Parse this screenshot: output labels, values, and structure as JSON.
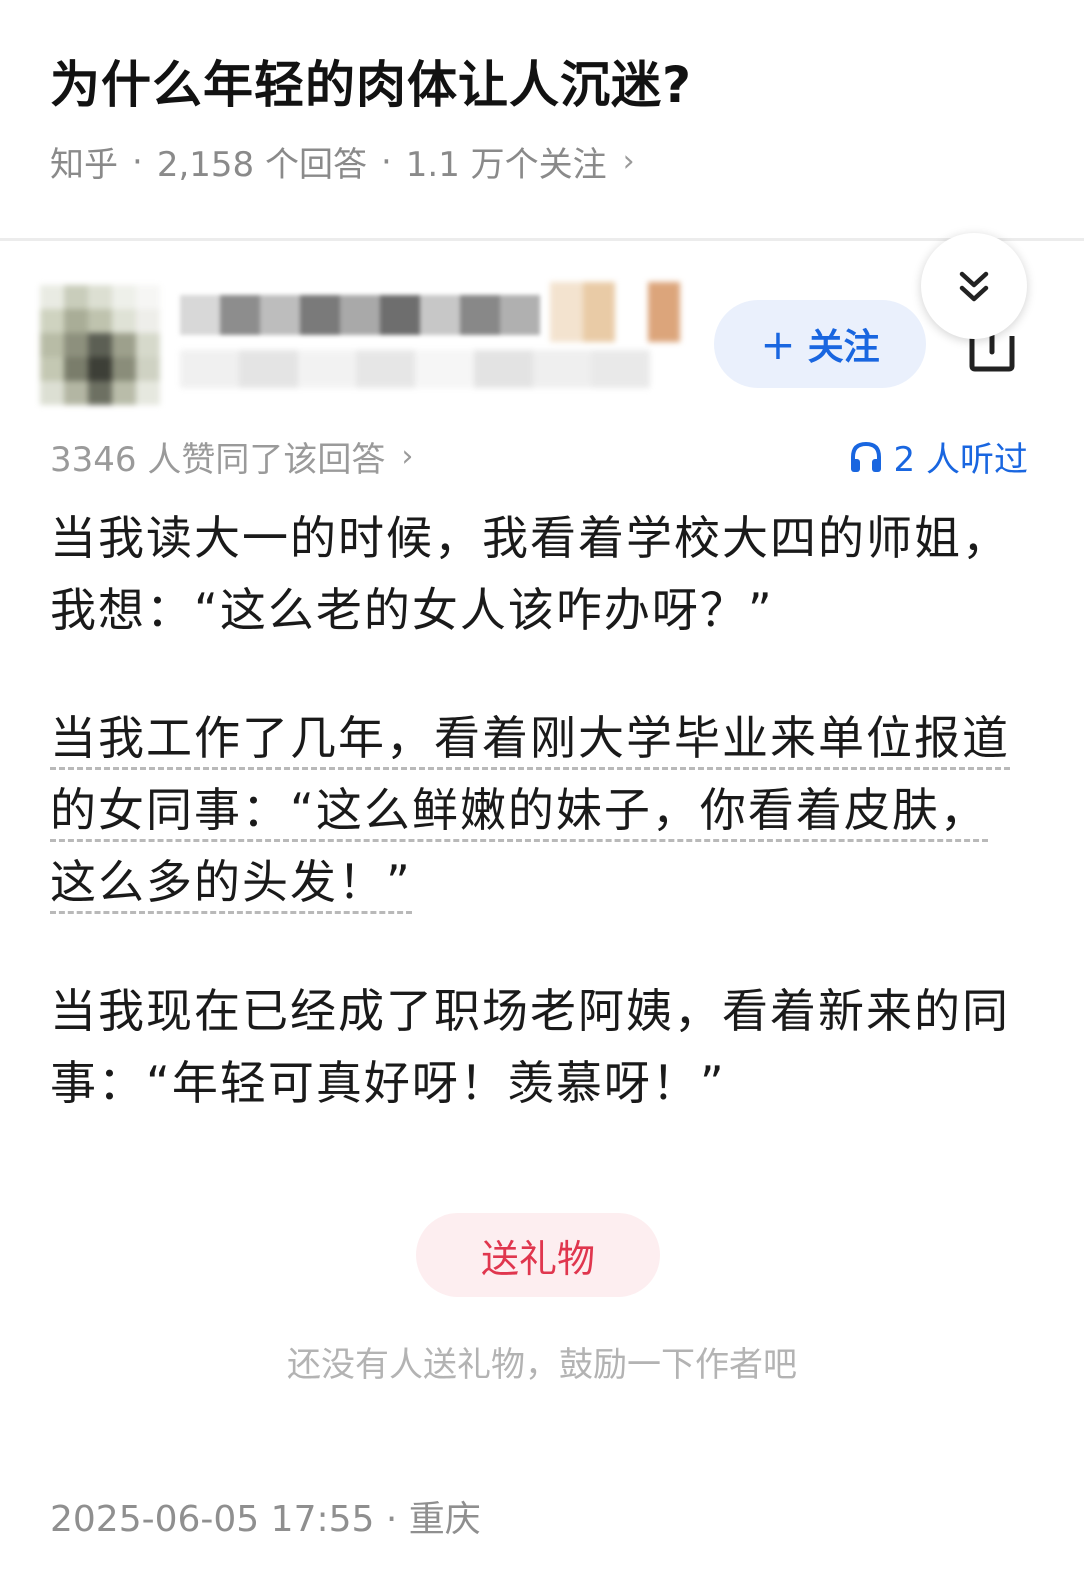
{
  "question": {
    "title": "为什么年轻的肉体让人沉迷?",
    "source": "知乎",
    "sep": "·",
    "answers": "2,158 个回答",
    "followers": "1.1 万个关注",
    "chevron": "›"
  },
  "author": {
    "follow_label": "关注",
    "follow_plus": "+",
    "avatar_icon": "avatar-blurred",
    "share_icon": "share-icon",
    "collapse_icon": "double-chevron-down-icon"
  },
  "stats": {
    "votes": "3346 人赞同了该回答",
    "listeners": "2 人听过",
    "chevron": "›"
  },
  "answer": {
    "p1": "当我读大一的时候，我看着学校大四的师姐，我想：“这么老的女人该咋办呀？”",
    "p2": "当我工作了几年，看着刚大学毕业来单位报道的女同事：“这么鲜嫩的妹子，你看着皮肤，这么多的头发！”",
    "p3": "当我现在已经成了职场老阿姨，看着新来的同事：“年轻可真好呀！羡慕呀！”"
  },
  "gift": {
    "button_label": "送礼物",
    "hint": "还没有人送礼物，鼓励一下作者吧"
  },
  "footer": {
    "datetime": "2025-06-05 17:55",
    "sep": "·",
    "location": "重庆"
  },
  "colors": {
    "accent_blue": "#1966e0",
    "gift_red": "#e0364e",
    "follow_bg": "#eaf0fc",
    "gift_bg": "#fdeef0"
  }
}
